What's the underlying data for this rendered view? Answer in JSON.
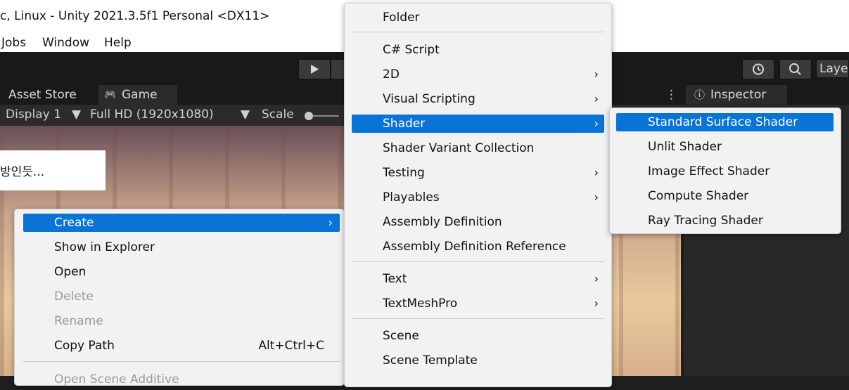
{
  "window": {
    "title": "c, Linux - Unity 2021.3.5f1 Personal <DX11>"
  },
  "menubar": {
    "items": [
      "Jobs",
      "Window",
      "Help"
    ]
  },
  "toolbar": {
    "layers_label": "Layer"
  },
  "tabs": {
    "asset_store": "Asset Store",
    "game": "Game",
    "inspector": "Inspector"
  },
  "gamebar": {
    "display": "Display 1",
    "resolution": "Full HD (1920x1080)",
    "scale": "Scale"
  },
  "scene": {
    "speech_text": "방인듯..."
  },
  "context_menu": {
    "items": [
      {
        "label": "Create"
      },
      {
        "label": "Show in Explorer"
      },
      {
        "label": "Open"
      },
      {
        "label": "Delete"
      },
      {
        "label": "Rename"
      },
      {
        "label": "Copy Path",
        "shortcut": "Alt+Ctrl+C"
      },
      {
        "label": "Open Scene Additive"
      }
    ]
  },
  "create_menu": {
    "items": [
      {
        "label": "Folder"
      },
      {
        "label": "C# Script"
      },
      {
        "label": "2D"
      },
      {
        "label": "Visual Scripting"
      },
      {
        "label": "Shader"
      },
      {
        "label": "Shader Variant Collection"
      },
      {
        "label": "Testing"
      },
      {
        "label": "Playables"
      },
      {
        "label": "Assembly Definition"
      },
      {
        "label": "Assembly Definition Reference"
      },
      {
        "label": "Text"
      },
      {
        "label": "TextMeshPro"
      },
      {
        "label": "Scene"
      },
      {
        "label": "Scene Template"
      }
    ]
  },
  "shader_menu": {
    "items": [
      {
        "label": "Standard Surface Shader"
      },
      {
        "label": "Unlit Shader"
      },
      {
        "label": "Image Effect Shader"
      },
      {
        "label": "Compute Shader"
      },
      {
        "label": "Ray Tracing Shader"
      }
    ]
  },
  "colors": {
    "highlight": "#0a74d6",
    "menu_bg": "#f2f2f2",
    "editor_dark": "#191919"
  }
}
